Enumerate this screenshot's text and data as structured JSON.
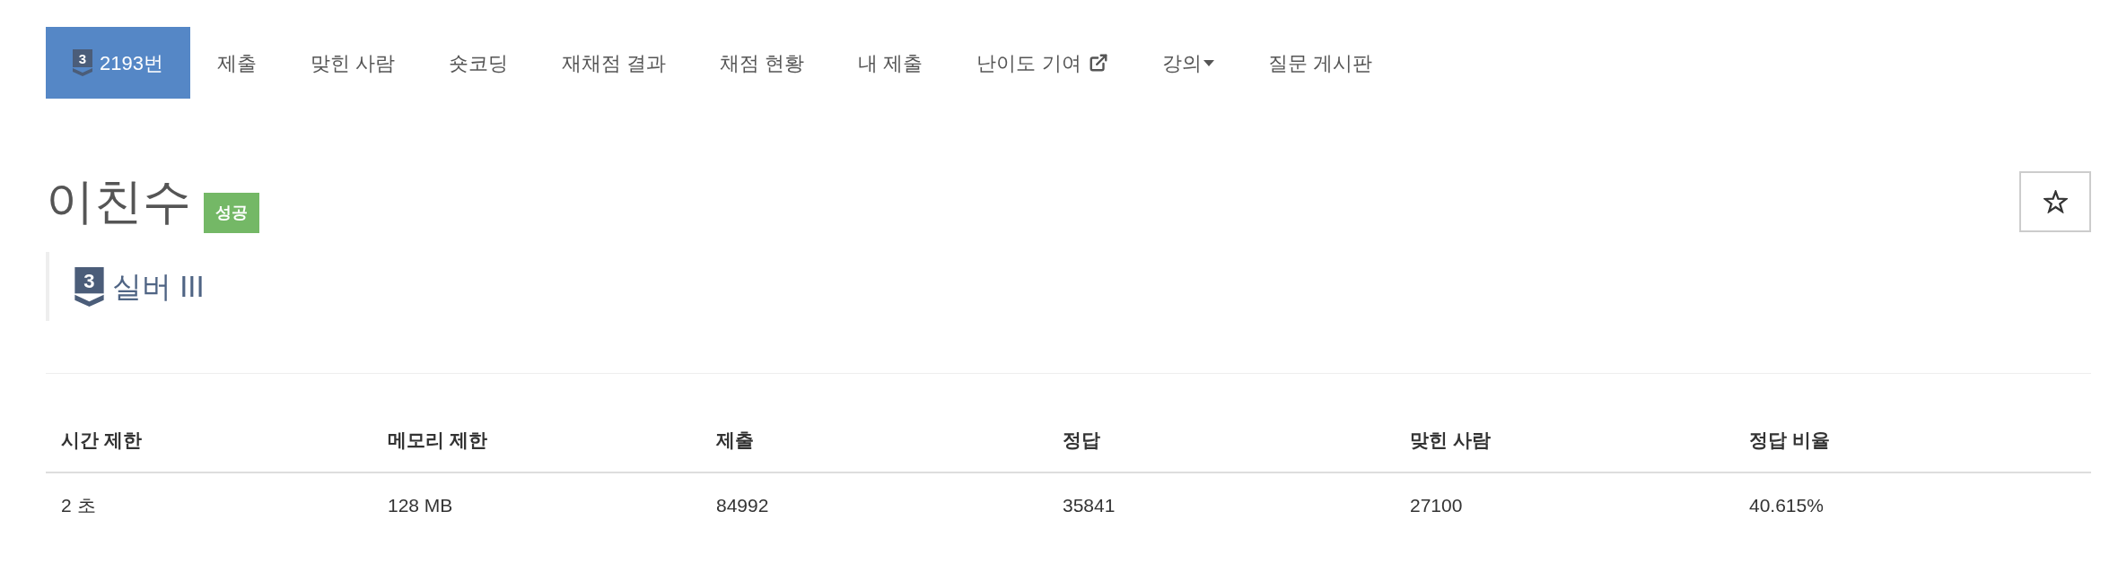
{
  "nav": {
    "tabs": [
      {
        "kind": "problem",
        "tier_icon": "3",
        "label": "2193번",
        "selected": true
      },
      {
        "kind": "link",
        "label": "제출",
        "selected": false
      },
      {
        "kind": "link",
        "label": "맞힌 사람",
        "selected": false
      },
      {
        "kind": "link",
        "label": "숏코딩",
        "selected": false
      },
      {
        "kind": "link",
        "label": "재채점 결과",
        "selected": false
      },
      {
        "kind": "link",
        "label": "채점 현황",
        "selected": false
      },
      {
        "kind": "link",
        "label": "내 제출",
        "selected": false
      },
      {
        "kind": "external",
        "label": "난이도 기여",
        "selected": false
      },
      {
        "kind": "dropdown",
        "label": "강의",
        "selected": false
      },
      {
        "kind": "link",
        "label": "질문 게시판",
        "selected": false
      }
    ]
  },
  "problem": {
    "title": "이친수",
    "result": "성공",
    "starred": false,
    "tier": {
      "icon": "3",
      "label": "실버 III"
    }
  },
  "table": {
    "columns": [
      "시간 제한",
      "메모리 제한",
      "제출",
      "정답",
      "맞힌 사람",
      "정답 비율"
    ],
    "rows": [
      [
        "2 초",
        "128 MB",
        "84992",
        "35841",
        "27100",
        "40.615%"
      ]
    ]
  }
}
